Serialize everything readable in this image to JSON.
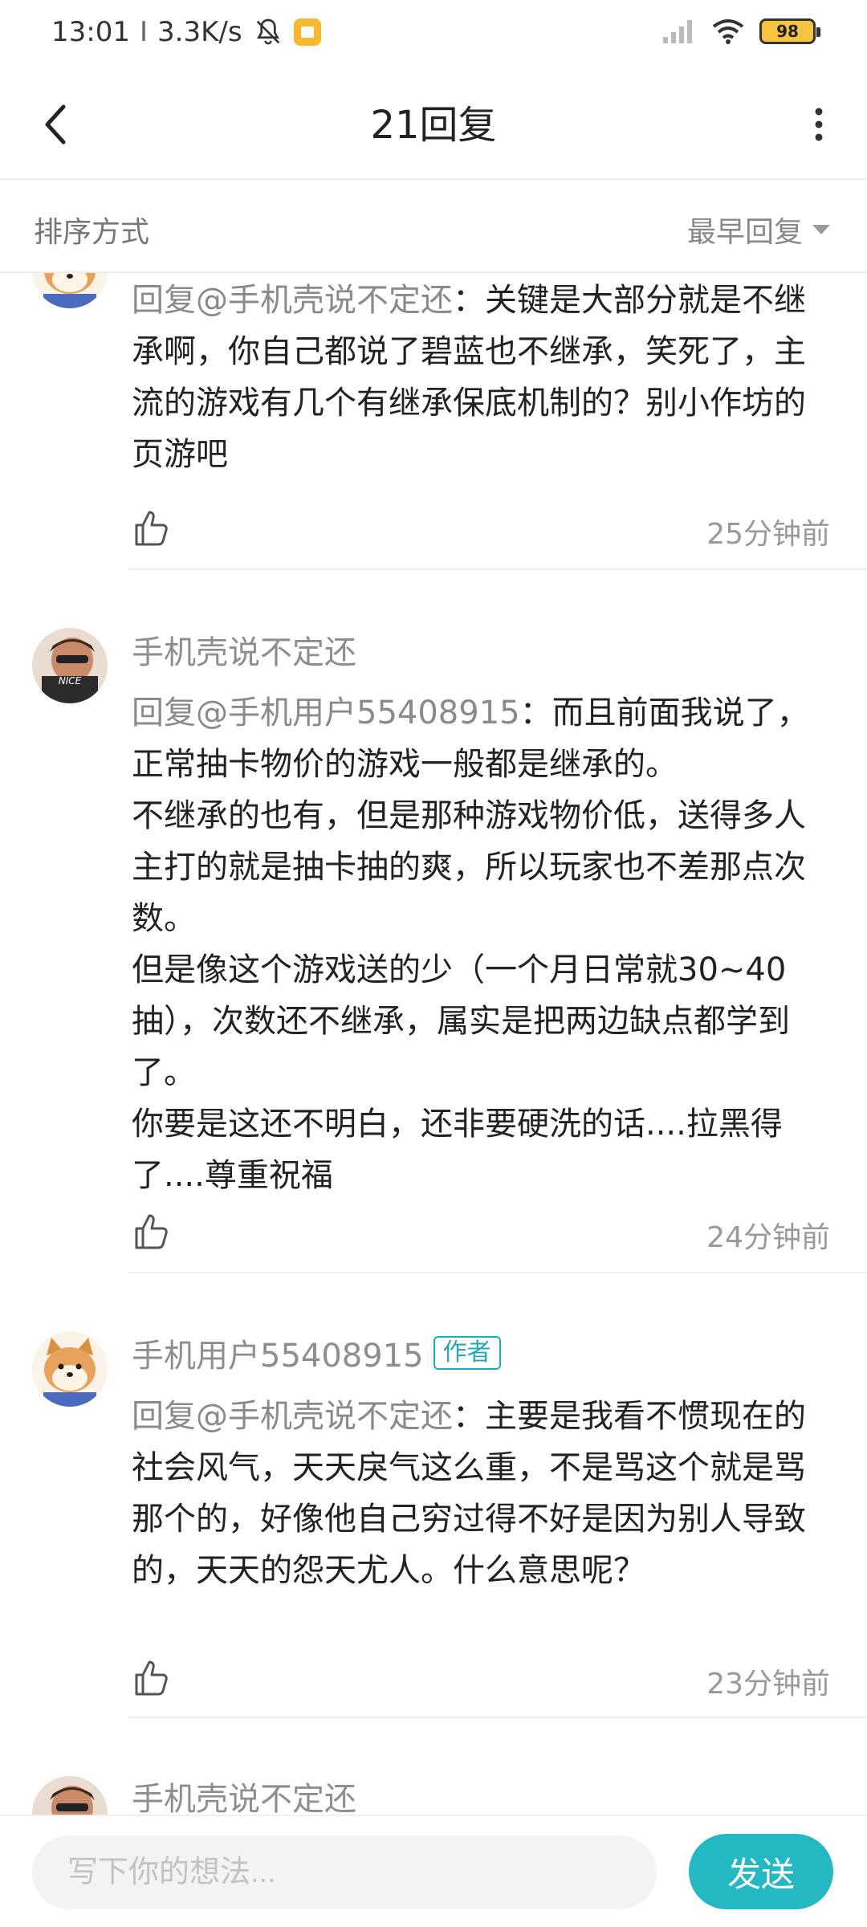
{
  "status_bar": {
    "time": "13:01",
    "speed": "3.3K/s",
    "battery": "98",
    "icons": [
      "bell-off-icon",
      "notification-app-icon",
      "signal-icon",
      "wifi-icon",
      "battery-icon"
    ]
  },
  "header": {
    "title": "21回复",
    "back_icon": "chevron-left-icon",
    "more_icon": "more-vertical-icon"
  },
  "sort": {
    "label": "排序方式",
    "selected": "最早回复"
  },
  "comments": [
    {
      "mention": "回复@手机壳说不定还",
      "text": "：关键是大部分就是不继承啊，你自己都说了碧蓝也不继承，笑死了，主流的游戏有几个有继承保底机制的？别小作坊的页游吧",
      "time": "25分钟前"
    },
    {
      "username": "手机壳说不定还",
      "mention": "回复@手机用户55408915",
      "text": "：而且前面我说了，正常抽卡物价的游戏一般都是继承的。\n不继承的也有，但是那种游戏物价低，送得多人主打的就是抽卡抽的爽，所以玩家也不差那点次数。\n但是像这个游戏送的少（一个月日常就30~40抽），次数还不继承，属实是把两边缺点都学到了。\n你要是这还不明白，还非要硬洗的话....拉黑得了....尊重祝福",
      "time": "24分钟前",
      "avatar_text": "NICE"
    },
    {
      "username": "手机用户55408915",
      "badge": "作者",
      "mention": "回复@手机壳说不定还",
      "text": "：主要是我看不惯现在的社会风气，天天戾气这么重，不是骂这个就是骂那个的，好像他自己穷过得不好是因为别人导致的，天天的怨天尤人。什么意思呢？",
      "time": "23分钟前"
    },
    {
      "username": "手机壳说不定还"
    }
  ],
  "input": {
    "placeholder": "写下你的想法...",
    "send_label": "发送"
  }
}
